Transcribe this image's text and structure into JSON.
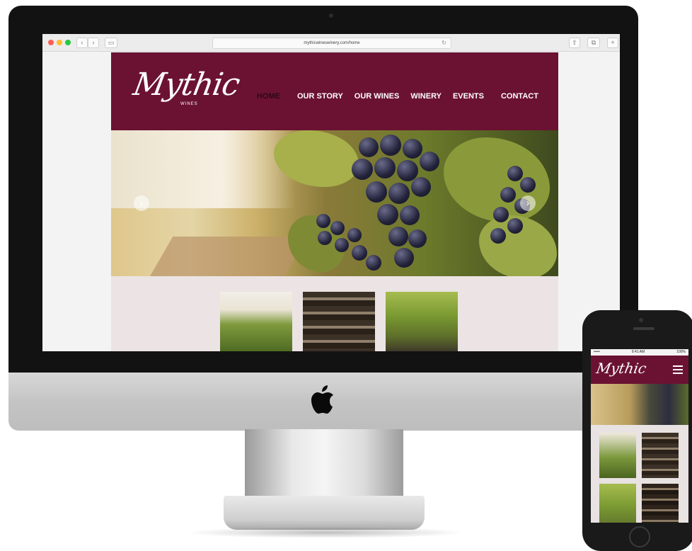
{
  "browser": {
    "url": "mythicwineswinery.com/home",
    "back_label": "‹",
    "forward_label": "›"
  },
  "site": {
    "logo": "Mythic",
    "logo_sub": "WINES",
    "nav": [
      {
        "label": "HOME",
        "active": true
      },
      {
        "label": "OUR STORY",
        "active": false
      },
      {
        "label": "OUR WINES",
        "active": false
      },
      {
        "label": "WINERY",
        "active": false
      },
      {
        "label": "EVENTS",
        "active": false
      },
      {
        "label": "CONTACT",
        "active": false
      }
    ],
    "slider_prev": "‹",
    "slider_next": "›"
  },
  "mobile": {
    "carrier": "••••• ",
    "time": "9:41 AM",
    "battery": "100%",
    "logo": "Mythic"
  },
  "colors": {
    "brand": "#6b1232",
    "thumb_strip": "#ece4e4"
  }
}
